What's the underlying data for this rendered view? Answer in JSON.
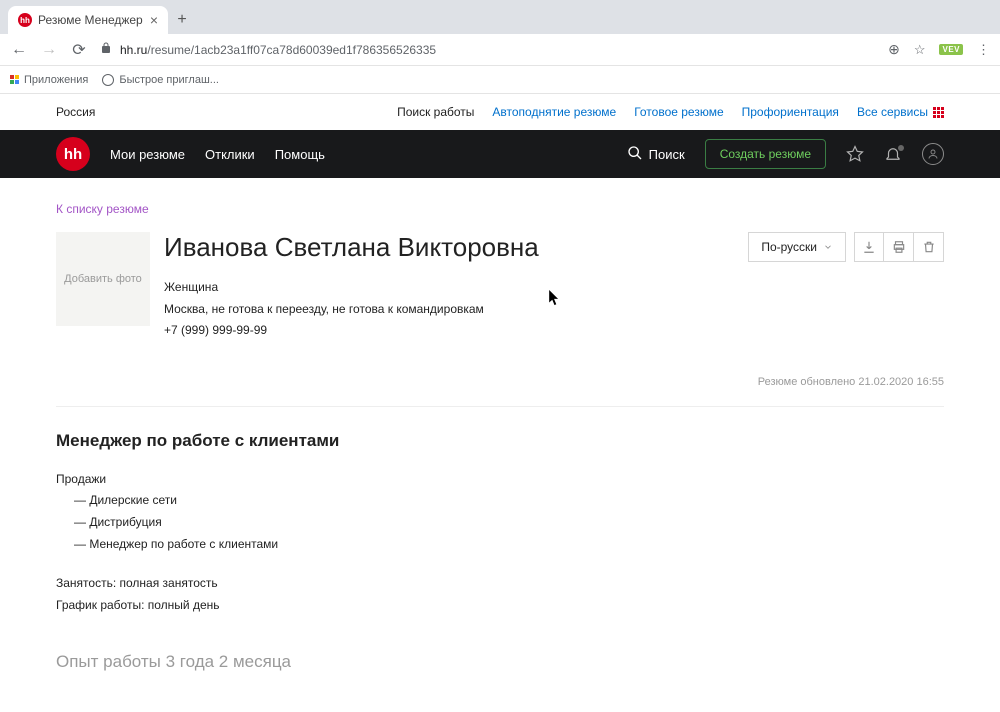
{
  "browser": {
    "tab_title": "Резюме Менеджер по работе",
    "url_domain": "hh.ru",
    "url_path": "/resume/1acb23a1ff07ca78d60039ed1f786356526335",
    "bookmarks_apps": "Приложения",
    "bookmarks_fast": "Быстрое приглаш...",
    "ext_badge": "VEV"
  },
  "topnav": {
    "region": "Россия",
    "search_work": "Поиск работы",
    "auto_raise": "Автоподнятие резюме",
    "ready_resume": "Готовое резюме",
    "career": "Профориентация",
    "all_services": "Все сервисы"
  },
  "header": {
    "logo": "hh",
    "my_resumes": "Мои резюме",
    "responses": "Отклики",
    "help": "Помощь",
    "search": "Поиск",
    "create_resume": "Создать резюме"
  },
  "page": {
    "back_link": "К списку резюме",
    "add_photo": "Добавить фото",
    "name": "Иванова Светлана Викторовна",
    "gender": "Женщина",
    "location": "Москва, не готова к переезду, не готова к командировкам",
    "phone": "+7 (999) 999-99-99",
    "lang_btn": "По-русски",
    "updated": "Резюме обновлено 21.02.2020 16:55",
    "position": "Менеджер по работе с клиентами",
    "dept": "Продажи",
    "spec1": "— Дилерские сети",
    "spec2": "— Дистрибуция",
    "spec3": "— Менеджер по работе с клиентами",
    "employment": "Занятость: полная занятость",
    "schedule": "График работы: полный день",
    "experience_title": "Опыт работы 3 года 2 месяца"
  }
}
